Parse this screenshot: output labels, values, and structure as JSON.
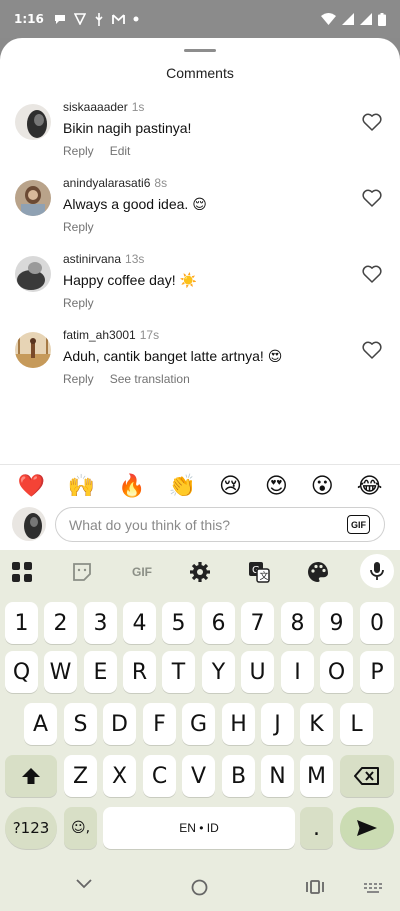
{
  "status": {
    "time": "1:16",
    "notif_icons": [
      "chat-bubble-icon",
      "shield-icon",
      "usb-icon",
      "gmail-icon"
    ],
    "right_icons": [
      "wifi-icon",
      "signal-icon",
      "signal-icon",
      "battery-icon"
    ]
  },
  "sheet": {
    "title": "Comments"
  },
  "comments": [
    {
      "user": "siskaaaader",
      "ago": "1s",
      "text": "Bikin nagih pastinya!",
      "actions": [
        "Reply",
        "Edit"
      ]
    },
    {
      "user": "anindyalarasati6",
      "ago": "8s",
      "text": "Always a good idea. 😌",
      "actions": [
        "Reply"
      ]
    },
    {
      "user": "astinirvana",
      "ago": "13s",
      "text": "Happy coffee day! ☀️",
      "actions": [
        "Reply"
      ]
    },
    {
      "user": "fatim_ah3001",
      "ago": "17s",
      "text": "Aduh, cantik banget latte artnya! 😍",
      "actions": [
        "Reply",
        "See translation"
      ]
    }
  ],
  "reactions": [
    "❤️",
    "🙌",
    "🔥",
    "👏",
    "😢",
    "😍",
    "😮",
    "😂"
  ],
  "composer": {
    "placeholder": "What do you think of this?",
    "value": "",
    "gif_label": "GIF"
  },
  "keyboard": {
    "toolbar": [
      "apps-grid-icon",
      "sticker-icon",
      "gif-icon",
      "gear-icon",
      "translate-icon",
      "palette-icon",
      "mic-icon"
    ],
    "toolbar_gif_label": "GIF",
    "row_numbers": [
      "1",
      "2",
      "3",
      "4",
      "5",
      "6",
      "7",
      "8",
      "9",
      "0"
    ],
    "row_q": [
      "Q",
      "W",
      "E",
      "R",
      "T",
      "Y",
      "U",
      "I",
      "O",
      "P"
    ],
    "row_a": [
      "A",
      "S",
      "D",
      "F",
      "G",
      "H",
      "J",
      "K",
      "L"
    ],
    "row_z": [
      "Z",
      "X",
      "C",
      "V",
      "B",
      "N",
      "M"
    ],
    "symbols_label": "?123",
    "emoji_comma_label": "☺,",
    "space_label": "EN • ID",
    "period_label": "."
  },
  "nav": [
    "back-chevron-icon",
    "home-circle-icon",
    "recents-icon",
    "keyboard-switch-icon"
  ]
}
